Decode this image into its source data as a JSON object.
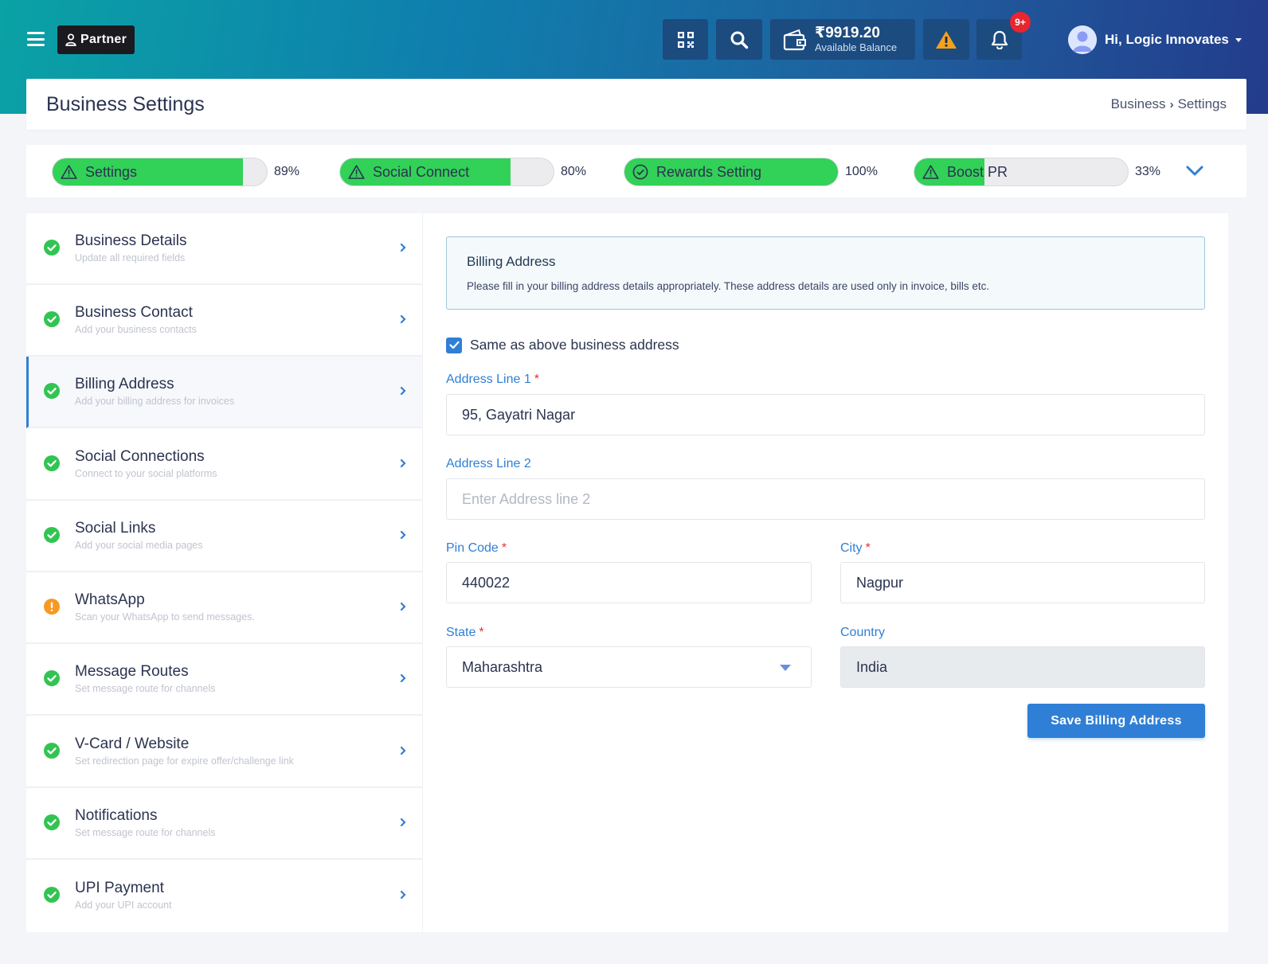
{
  "header": {
    "partner_label": "Partner",
    "wallet_amount": "₹9919.20",
    "wallet_sub": "Available Balance",
    "notification_badge": "9+",
    "user_greeting": "Hi, Logic Innovates"
  },
  "page": {
    "title": "Business Settings",
    "breadcrumb": [
      "Business",
      "Settings"
    ]
  },
  "progress": [
    {
      "label": "Settings",
      "percent_text": "89%",
      "value": 0.89,
      "status": "warning"
    },
    {
      "label": "Social Connect",
      "percent_text": "80%",
      "value": 0.8,
      "status": "warning"
    },
    {
      "label": "Rewards Setting",
      "percent_text": "100%",
      "value": 1.0,
      "status": "complete"
    },
    {
      "label": "Boost PR",
      "percent_text": "33%",
      "value": 0.33,
      "status": "warning"
    }
  ],
  "sidebar": {
    "items": [
      {
        "title": "Business Details",
        "subtitle": "Update all required fields",
        "status": "complete"
      },
      {
        "title": "Business Contact",
        "subtitle": "Add your business contacts",
        "status": "complete"
      },
      {
        "title": "Billing Address",
        "subtitle": "Add your billing address for invoices",
        "status": "complete",
        "active": true
      },
      {
        "title": "Social Connections",
        "subtitle": "Connect to your social platforms",
        "status": "complete"
      },
      {
        "title": "Social Links",
        "subtitle": "Add your social media pages",
        "status": "complete"
      },
      {
        "title": "WhatsApp",
        "subtitle": "Scan your WhatsApp to send messages.",
        "status": "warning"
      },
      {
        "title": "Message Routes",
        "subtitle": "Set message route for channels",
        "status": "complete"
      },
      {
        "title": "V-Card / Website",
        "subtitle": "Set redirection page for expire offer/challenge link",
        "status": "complete"
      },
      {
        "title": "Notifications",
        "subtitle": "Set message route for channels",
        "status": "complete"
      },
      {
        "title": "UPI Payment",
        "subtitle": "Add your UPI account",
        "status": "complete"
      }
    ]
  },
  "form": {
    "info_title": "Billing Address",
    "info_text": "Please fill in your billing address details appropriately. These address details are used only in invoice, bills etc.",
    "same_as_label": "Same as above business address",
    "same_as_checked": true,
    "address1_label": "Address Line 1",
    "address1_value": "95, Gayatri Nagar",
    "address2_label": "Address Line 2",
    "address2_placeholder": "Enter Address line 2",
    "pincode_label": "Pin Code",
    "pincode_value": "440022",
    "city_label": "City",
    "city_value": "Nagpur",
    "state_label": "State",
    "state_value": "Maharashtra",
    "country_label": "Country",
    "country_value": "India",
    "required_mark": "*",
    "save_label": "Save Billing Address"
  },
  "colors": {
    "accent": "#2f7fd6",
    "progress_green": "#32d158",
    "complete_green": "#32c452",
    "warning_orange": "#f59a23",
    "header_button": "#1c4b7f"
  }
}
